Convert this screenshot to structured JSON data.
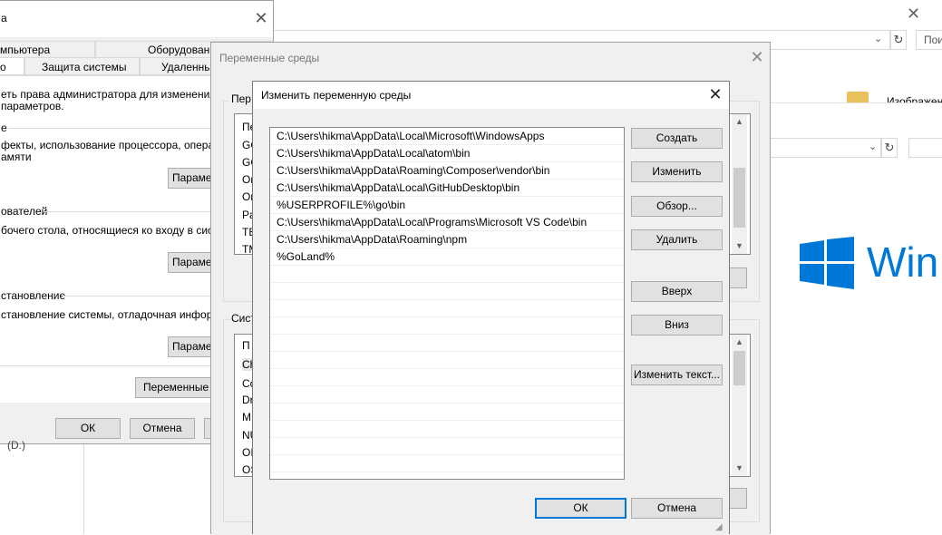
{
  "explorer_back": {
    "search_placeholder": "Пои",
    "folder_label": "Изображен",
    "win_logo_text": "Win"
  },
  "sys_props": {
    "title": "а",
    "tabs_row1": [
      "мпьютера",
      "Оборудование"
    ],
    "tabs_row2": [
      "о",
      "Защита системы",
      "Удаленный"
    ],
    "admin_note": [
      "еть права администратора для изменения бол",
      "параметров."
    ],
    "perf_header": "е",
    "perf_text": [
      "фекты, использование процессора, оперативн",
      "амяти"
    ],
    "param_btn": "Парамет",
    "profiles_header": "ователей",
    "profiles_text": "бочего стола, относящиеся ко входу в систему",
    "recovery_header": "становление",
    "recovery_text": "становление системы, отладочная информац",
    "env_btn": "Переменные ср",
    "ok": "ОК",
    "cancel": "Отмена",
    "drive_text": "(D.)"
  },
  "env_vars": {
    "title": "Переменные среды",
    "user_group_label": "Пер",
    "user_items": [
      "Пе",
      "GO",
      "GO",
      "On",
      "On",
      "Pa",
      "TE",
      "TM"
    ],
    "system_group_label": "Сист",
    "system_items": [
      "П",
      "Ch",
      "Co",
      "Dr",
      "M",
      "NU",
      "OI",
      "OS"
    ]
  },
  "edit_dialog": {
    "title": "Изменить переменную среды",
    "paths": [
      "C:\\Users\\hikma\\AppData\\Local\\Microsoft\\WindowsApps",
      "C:\\Users\\hikma\\AppData\\Local\\atom\\bin",
      "C:\\Users\\hikma\\AppData\\Roaming\\Composer\\vendor\\bin",
      "C:\\Users\\hikma\\AppData\\Local\\GitHubDesktop\\bin",
      "%USERPROFILE%\\go\\bin",
      "C:\\Users\\hikma\\AppData\\Local\\Programs\\Microsoft VS Code\\bin",
      "C:\\Users\\hikma\\AppData\\Roaming\\npm",
      "%GoLand%"
    ],
    "buttons": {
      "create": "Создать",
      "edit": "Изменить",
      "browse": "Обзор...",
      "delete": "Удалить",
      "up": "Вверх",
      "down": "Вниз",
      "edit_text": "Изменить текст...",
      "ok": "ОК",
      "cancel": "Отмена"
    }
  },
  "colors": {
    "win_logo": "#0078d7",
    "default_border": "#0078d7"
  }
}
